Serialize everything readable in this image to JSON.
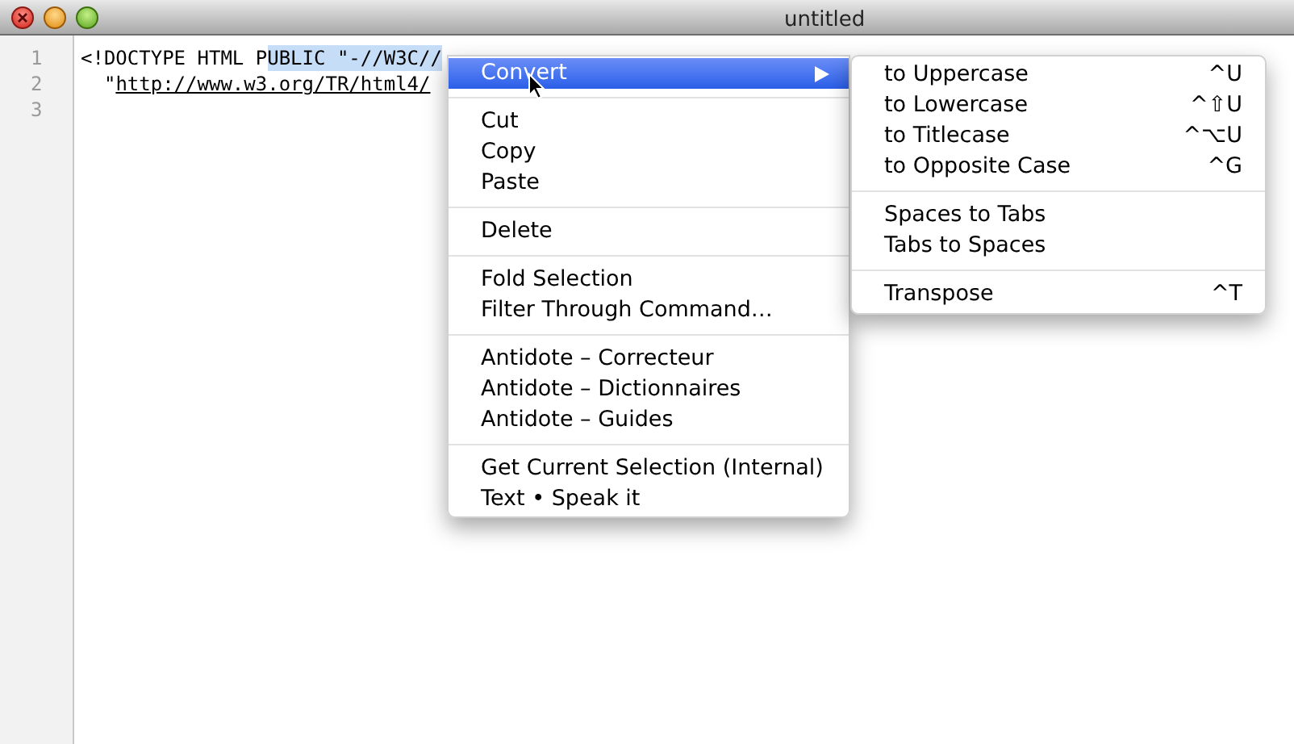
{
  "window": {
    "title": "untitled"
  },
  "editor": {
    "lines": [
      {
        "number": "1",
        "segments": [
          {
            "text": "<!DOCTYPE HTML P",
            "selected": false,
            "kind": "plain"
          },
          {
            "text": "UBLIC \"-//W3C//",
            "selected": true,
            "kind": "plain"
          }
        ]
      },
      {
        "number": "2",
        "segments": [
          {
            "text": "  \"",
            "selected": false,
            "kind": "plain"
          },
          {
            "text": "http://www.w3.org/TR/html4/",
            "selected": false,
            "kind": "link"
          }
        ]
      },
      {
        "number": "3"
      }
    ]
  },
  "context_menu": {
    "groups": [
      [
        {
          "label": "Convert",
          "selected": true,
          "submenu": true
        }
      ],
      [
        {
          "label": "Cut",
          "selected": false,
          "submenu": false
        },
        {
          "label": "Copy",
          "selected": false,
          "submenu": false
        },
        {
          "label": "Paste",
          "selected": false,
          "submenu": false
        }
      ],
      [
        {
          "label": "Delete",
          "selected": false,
          "submenu": false
        }
      ],
      [
        {
          "label": "Fold Selection",
          "selected": false,
          "submenu": false
        },
        {
          "label": "Filter Through Command…",
          "selected": false,
          "submenu": false
        }
      ],
      [
        {
          "label": "Antidote – Correcteur",
          "selected": false,
          "submenu": false
        },
        {
          "label": "Antidote – Dictionnaires",
          "selected": false,
          "submenu": false
        },
        {
          "label": "Antidote – Guides",
          "selected": false,
          "submenu": false
        }
      ],
      [
        {
          "label": "Get Current Selection (Internal)",
          "selected": false,
          "submenu": false
        },
        {
          "label": "Text • Speak it",
          "selected": false,
          "submenu": false
        }
      ]
    ]
  },
  "submenu": {
    "groups": [
      [
        {
          "label": "to Uppercase",
          "shortcut": "^U"
        },
        {
          "label": "to Lowercase",
          "shortcut": "^⇧U"
        },
        {
          "label": "to Titlecase",
          "shortcut": "^⌥U"
        },
        {
          "label": "to Opposite Case",
          "shortcut": "^G"
        }
      ],
      [
        {
          "label": "Spaces to Tabs"
        },
        {
          "label": "Tabs to Spaces"
        }
      ],
      [
        {
          "label": "Transpose",
          "shortcut": "^T"
        }
      ]
    ]
  }
}
